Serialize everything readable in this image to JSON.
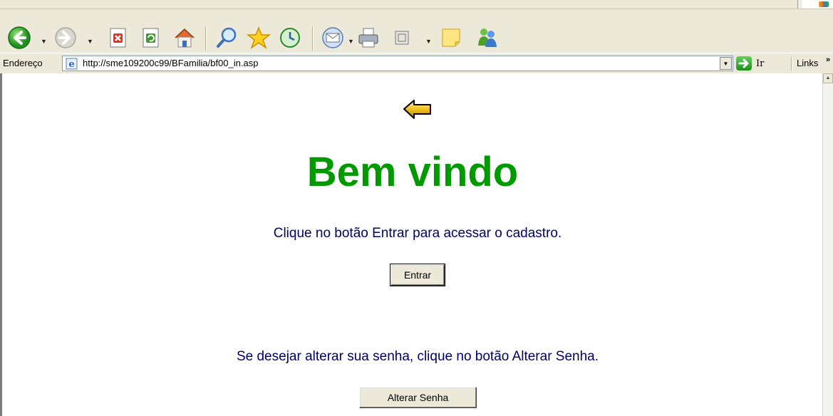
{
  "toolbar": {
    "buttons": [
      "back",
      "forward",
      "stop",
      "refresh",
      "home",
      "search",
      "favorites",
      "history",
      "mail",
      "print",
      "edit",
      "notes",
      "messenger"
    ]
  },
  "addressbar": {
    "label": "Endereço",
    "url": "http://sme109200c99/BFamilia/bf00_in.asp",
    "go_label": "Ir",
    "links_label": "Links"
  },
  "page": {
    "title": "Bem vindo",
    "intro": "Clique no botão Entrar para acessar o cadastro.",
    "enter_label": "Entrar",
    "password_prompt": "Se desejar alterar sua senha, clique no botão Alterar Senha.",
    "change_password_label": "Alterar Senha"
  },
  "colors": {
    "title": "#009900",
    "text": "#000066",
    "chrome": "#ece9d8"
  }
}
